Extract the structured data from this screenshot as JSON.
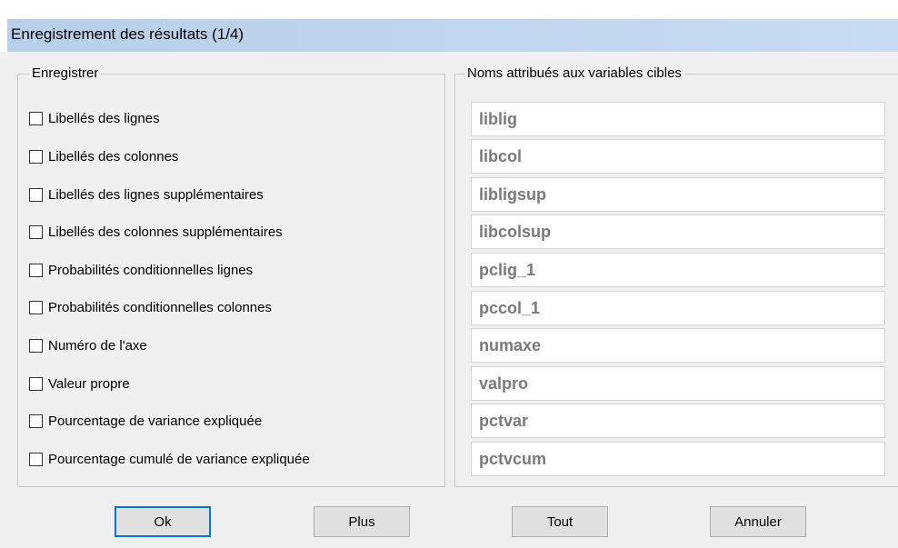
{
  "window": {
    "title": "Enregistrement des résultats (1/4)"
  },
  "save_group": {
    "legend": "Enregistrer",
    "items": [
      {
        "label": "Libellés des lignes",
        "checked": false
      },
      {
        "label": "Libellés des colonnes",
        "checked": false
      },
      {
        "label": "Libellés des lignes supplémentaires",
        "checked": false
      },
      {
        "label": "Libellés des colonnes supplémentaires",
        "checked": false
      },
      {
        "label": "Probabilités conditionnelles lignes",
        "checked": false
      },
      {
        "label": "Probabilités conditionnelles colonnes",
        "checked": false
      },
      {
        "label": "Numéro de l'axe",
        "checked": false
      },
      {
        "label": "Valeur propre",
        "checked": false
      },
      {
        "label": "Pourcentage de variance expliquée",
        "checked": false
      },
      {
        "label": "Pourcentage cumulé de variance expliquée",
        "checked": false
      }
    ]
  },
  "names_group": {
    "legend": "Noms attribués aux variables cibles",
    "fields": [
      "liblig",
      "libcol",
      "libligsup",
      "libcolsup",
      "pclig_1",
      "pccol_1",
      "numaxe",
      "valpro",
      "pctvar",
      "pctvcum"
    ]
  },
  "buttons": {
    "ok": "Ok",
    "plus": "Plus",
    "tout": "Tout",
    "annuler": "Annuler"
  },
  "colors": {
    "accent": "#0078d7",
    "titlebar": "#bfd5ee",
    "field_text": "#7a7a7a"
  }
}
